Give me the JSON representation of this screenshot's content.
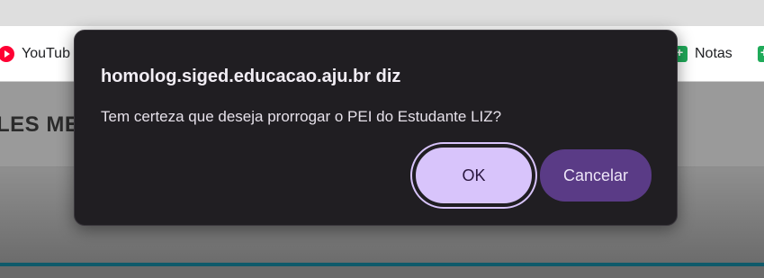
{
  "browser": {
    "bookmarks": [
      {
        "label": "YouTub",
        "icon": "youtube-icon"
      },
      {
        "label": "Notas",
        "icon": "notas-icon"
      }
    ]
  },
  "page": {
    "heading": "LES ME"
  },
  "dialog": {
    "title": "homolog.siged.educacao.aju.br diz",
    "message": "Tem certeza que deseja prorrogar o PEI do Estudante LIZ?",
    "ok_label": "OK",
    "cancel_label": "Cancelar"
  },
  "colors": {
    "dialog_bg": "#201e22",
    "ok_bg": "#d8c4fb",
    "cancel_bg": "#5a3b86",
    "accent_line": "#0f5a6a"
  }
}
